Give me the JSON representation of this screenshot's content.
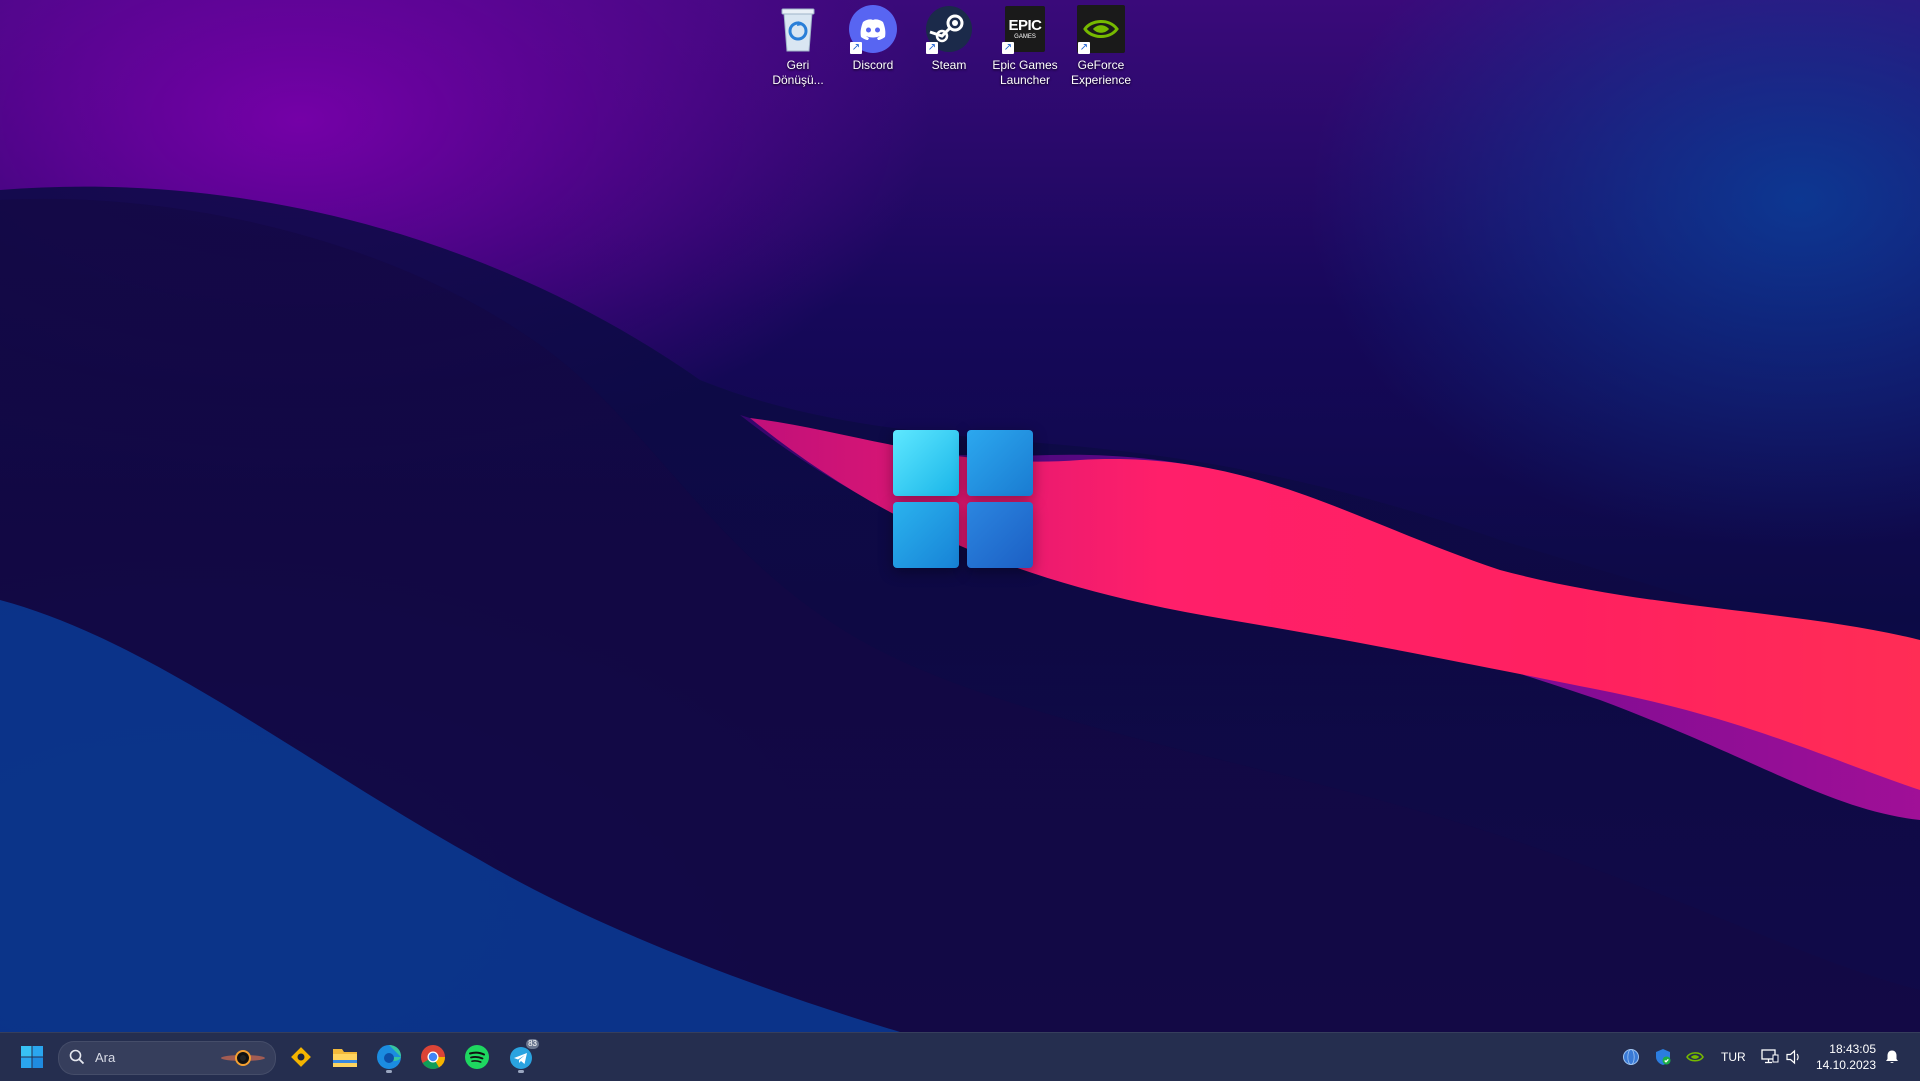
{
  "desktop": {
    "icons": [
      {
        "label": "Geri\nDönüşü...",
        "icon": "recycle-bin-icon"
      },
      {
        "label": "Discord",
        "icon": "discord-icon"
      },
      {
        "label": "Steam",
        "icon": "steam-icon"
      },
      {
        "label": "Epic Games\nLauncher",
        "icon": "epic-games-icon"
      },
      {
        "label": "GeForce\nExperience",
        "icon": "nvidia-geforce-icon"
      }
    ],
    "epic_logo_text": "EPIC",
    "epic_logo_sub": "GAMES"
  },
  "taskbar": {
    "search": {
      "placeholder": "Ara"
    },
    "pinned": [
      {
        "name": "start-button",
        "icon": "windows-start-icon"
      },
      {
        "name": "rewards-app",
        "icon": "rewards-diamond-icon"
      },
      {
        "name": "file-explorer",
        "icon": "folder-icon"
      },
      {
        "name": "edge",
        "icon": "edge-icon",
        "running": true
      },
      {
        "name": "chrome",
        "icon": "chrome-icon"
      },
      {
        "name": "spotify",
        "icon": "spotify-icon"
      },
      {
        "name": "telegram",
        "icon": "telegram-icon",
        "running": true,
        "badge": "83"
      }
    ],
    "tray": {
      "language": "TUR",
      "time": "18:43:05",
      "date": "14.10.2023"
    }
  },
  "colors": {
    "accent_pink": "#ff1e6e",
    "windows_blue": "#1a9be8",
    "spotify_green": "#1ed760",
    "nvidia_green": "#76b900",
    "discord_blurple": "#5865f2"
  }
}
